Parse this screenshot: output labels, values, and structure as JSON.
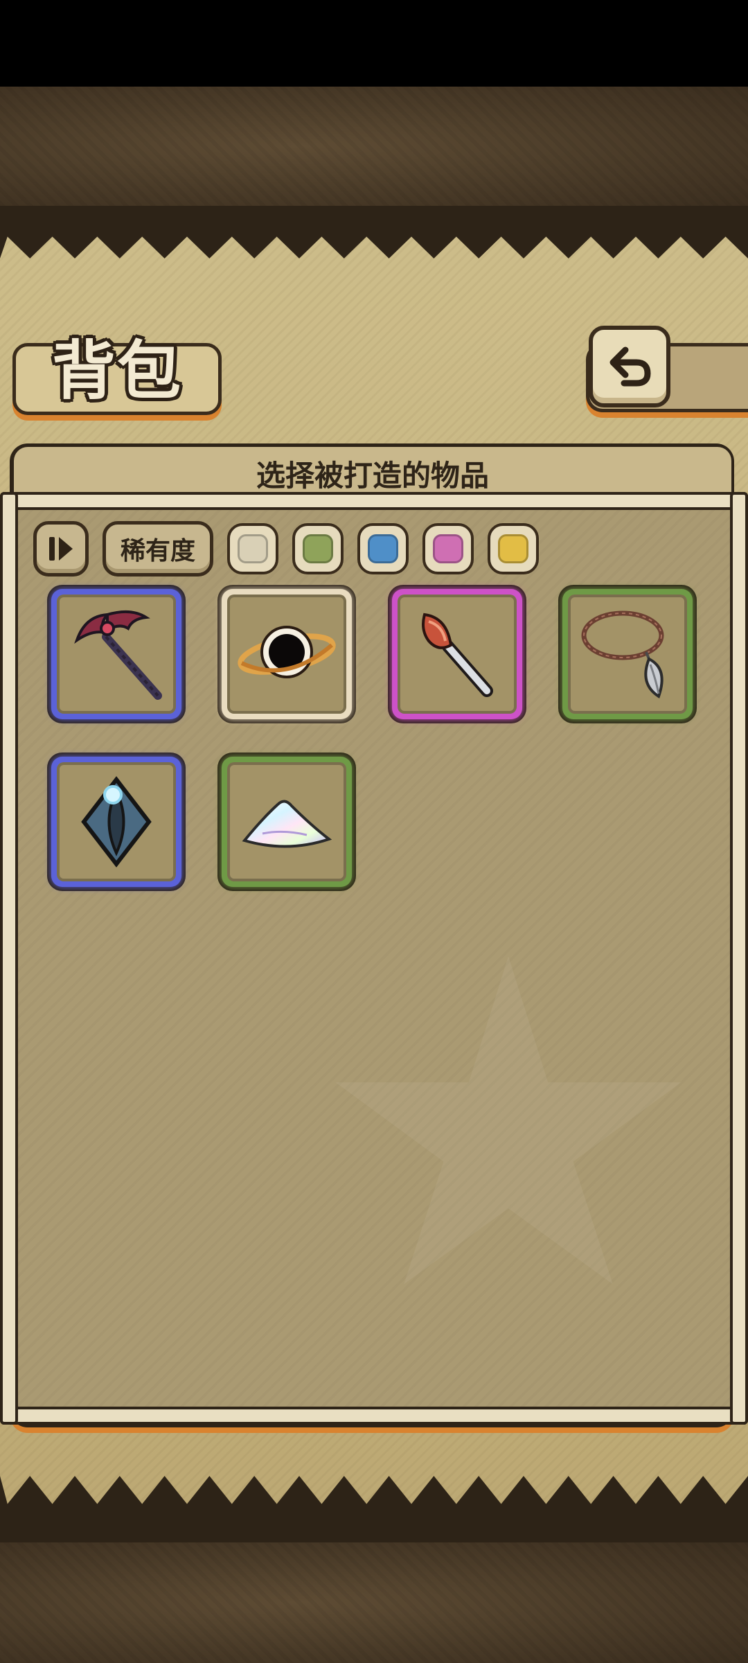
{
  "header": {
    "title": "背包"
  },
  "panel": {
    "title": "选择被打造的物品"
  },
  "toolbar": {
    "sort_icon": "sort-toggle-icon",
    "rarity_label": "稀有度",
    "rarity_filters": [
      {
        "name": "white",
        "color": "#d9d0b6"
      },
      {
        "name": "green",
        "color": "#8fa35a"
      },
      {
        "name": "blue",
        "color": "#4f8fc8"
      },
      {
        "name": "purple",
        "color": "#cf6fb3"
      },
      {
        "name": "gold",
        "color": "#e2bd45"
      }
    ]
  },
  "back_button": {
    "icon": "back-arrow-icon"
  },
  "items": [
    {
      "icon": "bat-wing-pickaxe-icon",
      "rarity": "blue",
      "rarity_color": "#5b62d8"
    },
    {
      "icon": "black-hole-icon",
      "rarity": "white",
      "rarity_color": "#e9dcc0"
    },
    {
      "icon": "spear-tip-icon",
      "rarity": "purple",
      "rarity_color": "#cd52c8"
    },
    {
      "icon": "leaf-necklace-icon",
      "rarity": "green",
      "rarity_color": "#6f9a46"
    },
    {
      "icon": "eye-crystal-icon",
      "rarity": "blue",
      "rarity_color": "#5b62d8"
    },
    {
      "icon": "prismatic-powder-icon",
      "rarity": "green",
      "rarity_color": "#6f9a46"
    }
  ]
}
